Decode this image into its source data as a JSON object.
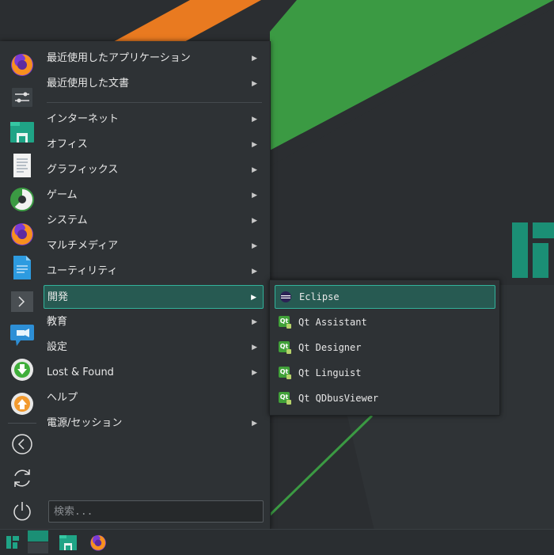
{
  "colors": {
    "accent": "#32b39b",
    "highlight_fill": "#275a52",
    "menu_bg": "#2e3235",
    "wallpaper_orange": "#e97a20",
    "wallpaper_green": "#3b9a43",
    "logo_teal": "#1b8f75"
  },
  "favorites": [
    {
      "icon": "firefox-icon"
    },
    {
      "icon": "system-settings-icon"
    },
    {
      "icon": "file-manager-icon"
    },
    {
      "icon": "text-editor-icon"
    },
    {
      "icon": "disk-usage-icon"
    },
    {
      "icon": "firefox-icon"
    },
    {
      "icon": "document-icon"
    },
    {
      "icon": "terminal-icon"
    },
    {
      "icon": "screencast-icon"
    },
    {
      "icon": "download-icon"
    },
    {
      "icon": "update-icon"
    }
  ],
  "session_icons": [
    "back-icon",
    "refresh-icon",
    "power-icon"
  ],
  "menu": {
    "recent": [
      {
        "label": "最近使用したアプリケーション"
      },
      {
        "label": "最近使用した文書"
      }
    ],
    "categories": [
      {
        "label": "インターネット"
      },
      {
        "label": "オフィス"
      },
      {
        "label": "グラフィックス"
      },
      {
        "label": "ゲーム"
      },
      {
        "label": "システム"
      },
      {
        "label": "マルチメディア"
      },
      {
        "label": "ユーティリティ"
      },
      {
        "label": "開発"
      },
      {
        "label": "教育"
      },
      {
        "label": "設定"
      },
      {
        "label": "Lost & Found"
      },
      {
        "label": "ヘルプ"
      },
      {
        "label": "電源/セッション"
      }
    ],
    "arrow_glyph": "▶",
    "search_placeholder": "検索...",
    "search_value": ""
  },
  "submenu": {
    "items": [
      {
        "label": "Eclipse",
        "icon": "eclipse-icon"
      },
      {
        "label": "Qt Assistant",
        "icon": "qt-icon"
      },
      {
        "label": "Qt Designer",
        "icon": "qt-icon"
      },
      {
        "label": "Qt Linguist",
        "icon": "qt-icon"
      },
      {
        "label": "Qt QDbusViewer",
        "icon": "qt-icon"
      }
    ],
    "qt_badge": "Qt"
  },
  "taskbar": {
    "items": [
      {
        "icon": "manjaro-menu-icon"
      },
      {
        "icon": "desktop-pager-icon"
      },
      {
        "icon": "file-manager-icon"
      },
      {
        "icon": "firefox-icon"
      }
    ]
  }
}
